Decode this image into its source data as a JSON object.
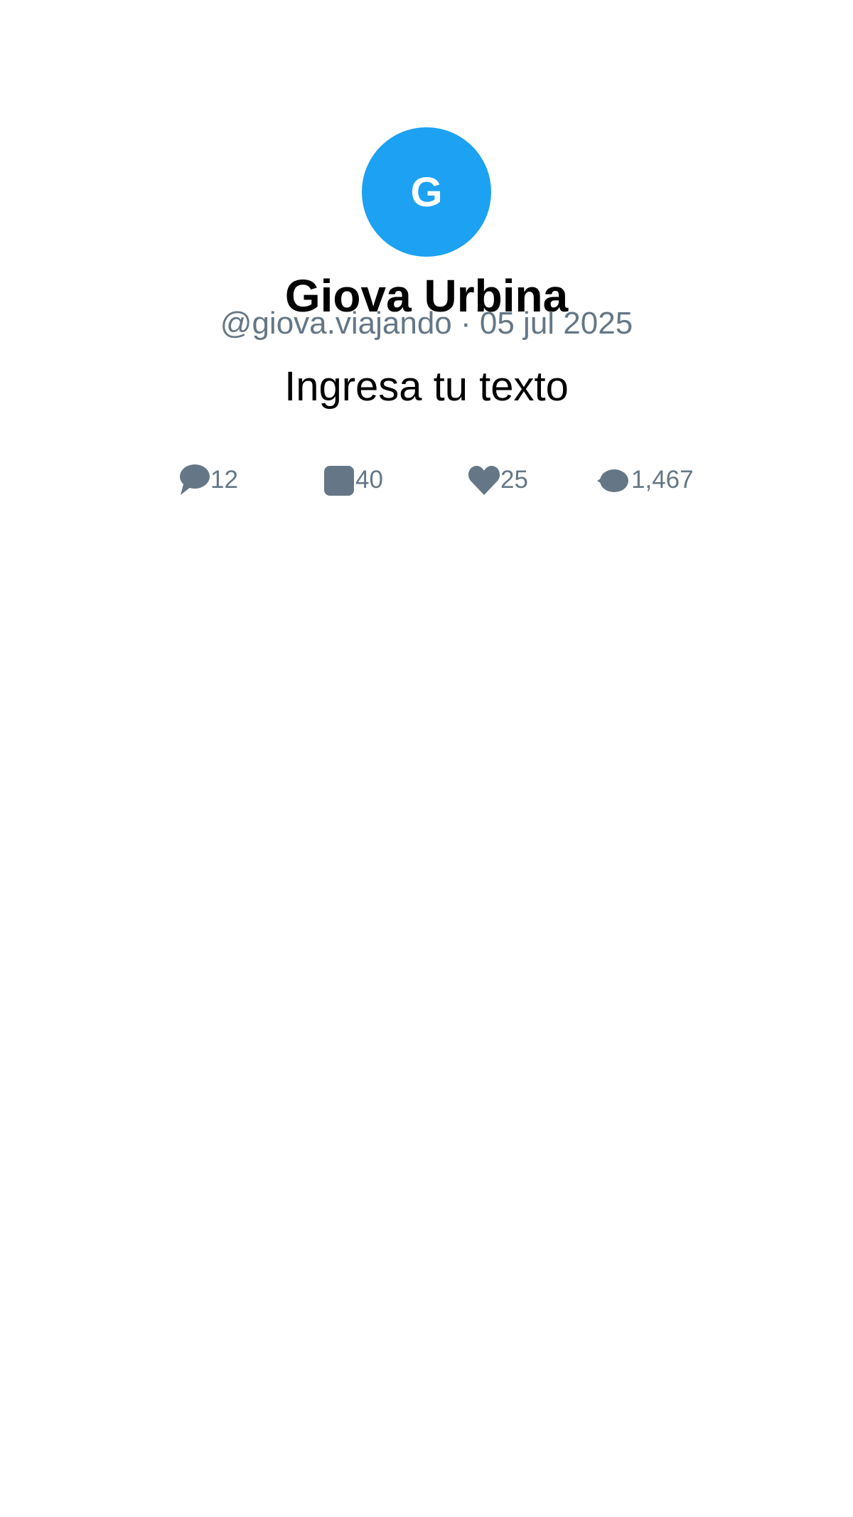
{
  "colors": {
    "accent": "#1da1f2",
    "secondary_text": "#657786",
    "icon": "#657786",
    "primary_text": "#000000",
    "background": "#ffffff"
  },
  "post": {
    "avatar_initial": "G",
    "display_name": "Giova Urbina",
    "meta": "@giova.viajando · 05 jul 2025",
    "text": "Ingresa tu texto",
    "stats": {
      "replies": {
        "icon": "reply-icon",
        "count": "12"
      },
      "reposts": {
        "icon": "repost-icon",
        "count": "40"
      },
      "likes": {
        "icon": "heart-icon",
        "count": "25"
      },
      "views": {
        "icon": "eye-icon",
        "count": "1,467"
      }
    }
  }
}
